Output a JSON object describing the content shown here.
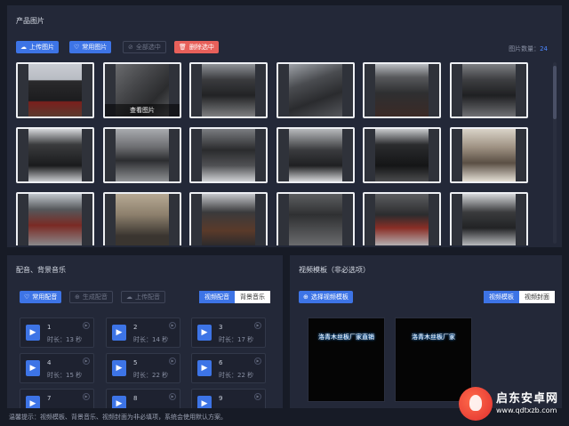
{
  "product_images": {
    "title": "产品图片",
    "buttons": {
      "upload": "上传图片",
      "common": "常用图片",
      "select_all": "全部选中",
      "delete_selected": "删除选中"
    },
    "count_label": "图片数量：",
    "count_value": "24",
    "view_label": "查看图片"
  },
  "music": {
    "title": "配音、背景音乐",
    "buttons": {
      "common": "常用配音",
      "generate": "生成配音",
      "upload": "上传配音"
    },
    "tabs": [
      "视频配音",
      "背景音乐"
    ],
    "tracks": [
      {
        "num": "1",
        "duration": "时长：13 秒"
      },
      {
        "num": "2",
        "duration": "时长：14 秒"
      },
      {
        "num": "3",
        "duration": "时长：17 秒"
      },
      {
        "num": "4",
        "duration": "时长：15 秒"
      },
      {
        "num": "5",
        "duration": "时长：22 秒"
      },
      {
        "num": "6",
        "duration": "时长：22 秒"
      },
      {
        "num": "7",
        "duration": ""
      },
      {
        "num": "8",
        "duration": ""
      },
      {
        "num": "9",
        "duration": ""
      }
    ]
  },
  "video": {
    "title": "视频模板（非必选项）",
    "select_button": "选择视频模板",
    "tabs": [
      "视频模板",
      "视频封面"
    ],
    "templates": [
      {
        "text": "洛青木丝板厂家直销"
      },
      {
        "text": "洛青木丝板厂家"
      }
    ]
  },
  "footer": {
    "tip": "温馨提示：视频模板、背景音乐、视频封面为非必填项，系统会使用默认方案。"
  },
  "watermark": {
    "name": "启东安卓网",
    "url": "www.qdtxzb.com"
  },
  "colors": {
    "accent": "#3d74e6",
    "danger": "#e8605a",
    "panel": "#232838",
    "background": "#171b26"
  }
}
